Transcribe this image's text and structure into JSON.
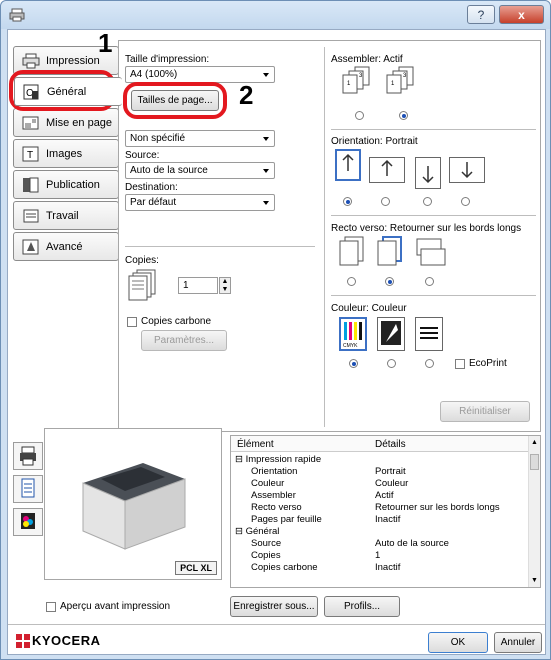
{
  "window": {
    "help": "?",
    "close": "x"
  },
  "tabs": [
    {
      "label": "Impression",
      "icon": "printer-tab-icon"
    },
    {
      "label": "Général",
      "icon": "general-tab-icon"
    },
    {
      "label": "Mise en page",
      "icon": "layout-tab-icon"
    },
    {
      "label": "Images",
      "icon": "images-tab-icon"
    },
    {
      "label": "Publication",
      "icon": "publication-tab-icon"
    },
    {
      "label": "Travail",
      "icon": "job-tab-icon"
    },
    {
      "label": "Avancé",
      "icon": "advanced-tab-icon"
    }
  ],
  "callouts": {
    "one": "1",
    "two": "2"
  },
  "general": {
    "print_size_label": "Taille d'impression:",
    "print_size_value": "A4 (100%)",
    "page_sizes_button": "Tailles de page...",
    "media_type_value": "Non spécifié",
    "source_label": "Source:",
    "source_value": "Auto de la source",
    "destination_label": "Destination:",
    "destination_value": "Par défaut",
    "copies_label": "Copies:",
    "copies_value": "1",
    "carbon_copies_label": "Copies carbone",
    "params_button": "Paramètres..."
  },
  "right": {
    "collate_label": "Assembler: Actif",
    "orientation_label": "Orientation: Portrait",
    "duplex_label": "Recto verso: Retourner sur les bords longs",
    "color_label": "Couleur: Couleur",
    "ecoprint_label": "EcoPrint",
    "reset_button": "Réinitialiser"
  },
  "grid": {
    "col_item": "Élément",
    "col_details": "Détails",
    "rows": [
      {
        "item": "⊟ Impression rapide",
        "details": "",
        "indent": 0
      },
      {
        "item": "Orientation",
        "details": "Portrait",
        "indent": 1
      },
      {
        "item": "Couleur",
        "details": "Couleur",
        "indent": 1
      },
      {
        "item": "Assembler",
        "details": "Actif",
        "indent": 1
      },
      {
        "item": "Recto verso",
        "details": "Retourner sur les bords longs",
        "indent": 1
      },
      {
        "item": "Pages par feuille",
        "details": "Inactif",
        "indent": 1
      },
      {
        "item": "⊟ Général",
        "details": "",
        "indent": 0
      },
      {
        "item": "Source",
        "details": "Auto de la source",
        "indent": 1
      },
      {
        "item": "Copies",
        "details": "1",
        "indent": 1
      },
      {
        "item": "Copies carbone",
        "details": "Inactif",
        "indent": 1
      }
    ]
  },
  "preview": {
    "badge": "PCL XL",
    "preview_checkbox_label": "Aperçu avant impression"
  },
  "bottom": {
    "save_as_button": "Enregistrer sous...",
    "profiles_button": "Profils...",
    "brand": "KYOCERA",
    "ok_button": "OK",
    "cancel_button": "Annuler"
  },
  "colors": {
    "callout_ring": "#e3181f",
    "selection_blue": "#3c70c4",
    "brand_red": "#d2202f"
  }
}
